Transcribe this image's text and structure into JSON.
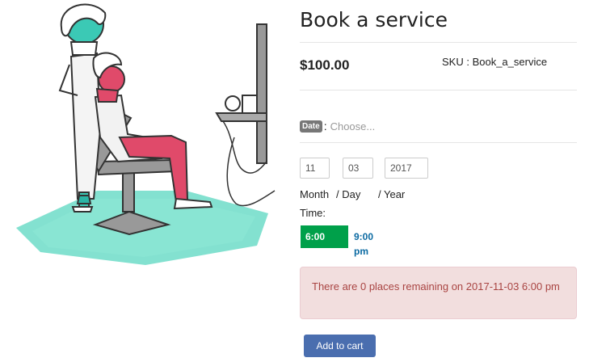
{
  "product": {
    "title": "Book a service",
    "price": "$100.00",
    "sku": "SKU : Book_a_service"
  },
  "date": {
    "badge": "Date",
    "colon": ":",
    "placeholder": "Choose..."
  },
  "date_fields": {
    "month": "11",
    "day": "03",
    "year": "2017",
    "month_label": "Month",
    "day_label": "/ Day",
    "year_label": "/ Year"
  },
  "time": {
    "label": "Time:",
    "slots": [
      "6:00",
      "9:00 pm"
    ],
    "selected": "6:00"
  },
  "alert": {
    "message": "There are 0 places remaining on 2017-11-03 6:00 pm"
  },
  "cart": {
    "button": "Add to cart"
  },
  "colors": {
    "selected_slot": "#00a04a",
    "alert_bg": "#f2dede",
    "button": "#4a6eaf"
  }
}
